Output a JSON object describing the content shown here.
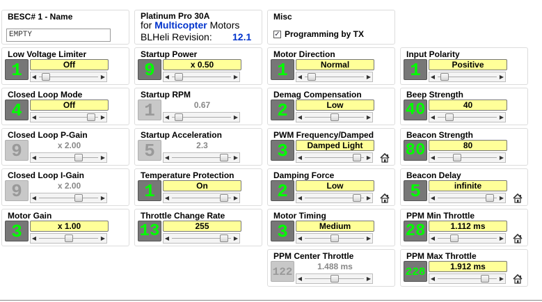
{
  "name_panel": {
    "title": "BESC# 1 - Name",
    "value": "EMPTY"
  },
  "info_panel": {
    "line1": "Platinum Pro 30A",
    "for_label": "for",
    "type": "Multicopter",
    "motors_label": "Motors",
    "revision_label": "BLHeli Revision:",
    "revision": "12.1"
  },
  "misc_panel": {
    "title": "Misc",
    "checkbox_label": "Programming by TX",
    "checked": true
  },
  "params": [
    {
      "id": "low-voltage-limiter",
      "title": "Low Voltage Limiter",
      "num": "1",
      "value": "Off",
      "pos": 0.05,
      "enabled": true,
      "house": false
    },
    {
      "id": "startup-power",
      "title": "Startup Power",
      "num": "9",
      "value": "x 0.50",
      "pos": 0.05,
      "enabled": true,
      "house": false
    },
    {
      "id": "motor-direction",
      "title": "Motor Direction",
      "num": "1",
      "value": "Normal",
      "pos": 0.05,
      "enabled": true,
      "house": false
    },
    {
      "id": "input-polarity",
      "title": "Input Polarity",
      "num": "1",
      "value": "Positive",
      "pos": 0.05,
      "enabled": true,
      "house": false
    },
    {
      "id": "closed-loop-mode",
      "title": "Closed Loop Mode",
      "num": "4",
      "value": "Off",
      "pos": 0.95,
      "enabled": true,
      "house": false
    },
    {
      "id": "startup-rpm",
      "title": "Startup RPM",
      "num": "1",
      "value": "0.67",
      "pos": 0.05,
      "enabled": false,
      "house": false
    },
    {
      "id": "demag-compensation",
      "title": "Demag Compensation",
      "num": "2",
      "value": "Low",
      "pos": 0.5,
      "enabled": true,
      "house": false
    },
    {
      "id": "beep-strength",
      "title": "Beep Strength",
      "num": "40",
      "value": "40",
      "pos": 0.15,
      "enabled": true,
      "house": false
    },
    {
      "id": "closed-loop-p-gain",
      "title": "Closed Loop P-Gain",
      "num": "9",
      "value": "x 2.00",
      "pos": 0.7,
      "enabled": false,
      "house": false
    },
    {
      "id": "startup-acceleration",
      "title": "Startup Acceleration",
      "num": "5",
      "value": "2.3",
      "pos": 0.95,
      "enabled": false,
      "house": false
    },
    {
      "id": "pwm-frequency-damped",
      "title": "PWM Frequency/Damped",
      "num": "3",
      "value": "Damped Light",
      "pos": 0.95,
      "enabled": true,
      "house": true
    },
    {
      "id": "beacon-strength",
      "title": "Beacon Strength",
      "num": "80",
      "value": "80",
      "pos": 0.3,
      "enabled": true,
      "house": false
    },
    {
      "id": "closed-loop-i-gain",
      "title": "Closed Loop I-Gain",
      "num": "9",
      "value": "x 2.00",
      "pos": 0.7,
      "enabled": false,
      "house": false
    },
    {
      "id": "temperature-protection",
      "title": "Temperature Protection",
      "num": "1",
      "value": "On",
      "pos": 0.95,
      "enabled": true,
      "house": false
    },
    {
      "id": "damping-force",
      "title": "Damping Force",
      "num": "2",
      "value": "Low",
      "pos": 0.95,
      "enabled": true,
      "house": true
    },
    {
      "id": "beacon-delay",
      "title": "Beacon Delay",
      "num": "5",
      "value": "infinite",
      "pos": 0.95,
      "enabled": true,
      "house": true
    },
    {
      "id": "motor-gain",
      "title": "Motor Gain",
      "num": "3",
      "value": "x 1.00",
      "pos": 0.5,
      "enabled": true,
      "house": false
    },
    {
      "id": "throttle-change-rate",
      "title": "Throttle Change  Rate",
      "num": "13",
      "value": "255",
      "pos": 0.95,
      "enabled": true,
      "house": false
    },
    {
      "id": "motor-timing",
      "title": "Motor Timing",
      "num": "3",
      "value": "Medium",
      "pos": 0.5,
      "enabled": true,
      "house": false
    },
    {
      "id": "ppm-min-throttle",
      "title": "PPM Min Throttle",
      "num": "28",
      "value": "1.112 ms",
      "pos": 0.25,
      "enabled": true,
      "house": true
    },
    {
      "id": "ppm-center-throttle",
      "title": "PPM Center Throttle",
      "num": "122",
      "value": "1.488 ms",
      "pos": 0.5,
      "enabled": false,
      "house": false
    },
    {
      "id": "ppm-max-throttle",
      "title": "PPM Max Throttle",
      "num": "228",
      "value": "1.912 ms",
      "pos": 0.85,
      "enabled": true,
      "house": true
    }
  ]
}
